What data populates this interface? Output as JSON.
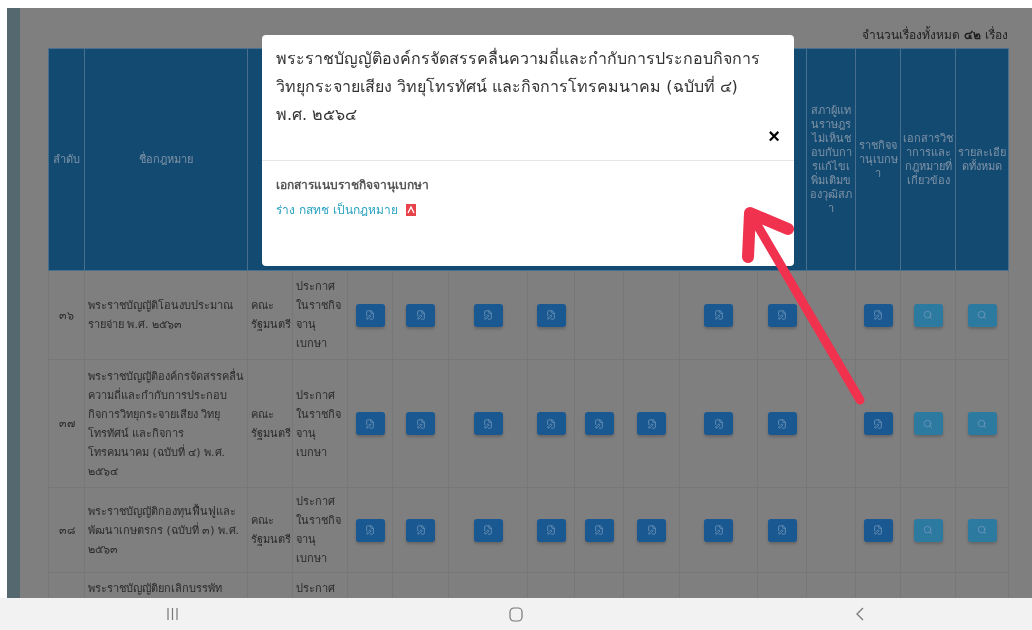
{
  "summary": "จำนวนเรื่องทั้งหมด **๔๒** เรื่อง",
  "table": {
    "columns": [
      {
        "label": "ลำดับ"
      },
      {
        "label": "ชื่อกฎหมาย"
      },
      {
        "label": "สภาผู้แทนราษฎรไม่เห็นชอบกับการแก้ไขเพิ่มเติมของวุฒิสภา"
      },
      {
        "label": "ราชกิจจานุเบกษา"
      },
      {
        "label": "เอกสารวิชาการและกฎหมายที่เกี่ยวข้อง"
      },
      {
        "label": "รายละเอียดทั้งหมด"
      }
    ],
    "rows": [
      {
        "number": "๓๖",
        "name": "พระราชบัญญัติโอนงบประมาณรายจ่าย พ.ศ. ๒๕๖๓",
        "proposer": "คณะรัฐมนตรี",
        "status": "ประกาศในราชกิจจานุเบกษา",
        "actions": [
          {
            "kind": "edit"
          },
          {
            "kind": "edit"
          },
          {
            "kind": "edit"
          },
          {
            "kind": "edit"
          },
          {
            "kind": "empty"
          },
          {
            "kind": "empty"
          },
          {
            "kind": "edit"
          },
          {
            "kind": "edit"
          },
          {
            "kind": "empty"
          },
          {
            "kind": "edit"
          },
          {
            "kind": "search"
          },
          {
            "kind": "search"
          }
        ]
      },
      {
        "number": "๓๗",
        "name": "พระราชบัญญัติองค์กรจัดสรรคลื่นความถี่และกำกับการประกอบกิจการวิทยุกระจายเสียง วิทยุโทรทัศน์ และกิจการโทรคมนาคม (ฉบับที่ ๔) พ.ศ. ๒๕๖๔",
        "proposer": "คณะรัฐมนตรี",
        "status": "ประกาศในราชกิจจานุเบกษา",
        "actions": [
          {
            "kind": "edit"
          },
          {
            "kind": "edit"
          },
          {
            "kind": "edit"
          },
          {
            "kind": "edit"
          },
          {
            "kind": "edit"
          },
          {
            "kind": "edit"
          },
          {
            "kind": "edit"
          },
          {
            "kind": "edit"
          },
          {
            "kind": "empty"
          },
          {
            "kind": "edit"
          },
          {
            "kind": "search"
          },
          {
            "kind": "search"
          }
        ]
      },
      {
        "number": "๓๘",
        "name": "พระราชบัญญัติกองทุนฟื้นฟูและพัฒนาเกษตรกร (ฉบับที่ ๓) พ.ศ. ๒๕๖๓",
        "proposer": "คณะรัฐมนตรี",
        "status": "ประกาศในราชกิจจานุเบกษา",
        "actions": [
          {
            "kind": "edit"
          },
          {
            "kind": "edit"
          },
          {
            "kind": "edit"
          },
          {
            "kind": "edit"
          },
          {
            "kind": "edit"
          },
          {
            "kind": "edit"
          },
          {
            "kind": "edit"
          },
          {
            "kind": "edit"
          },
          {
            "kind": "empty"
          },
          {
            "kind": "edit"
          },
          {
            "kind": "search"
          },
          {
            "kind": "search"
          }
        ]
      },
      {
        "name": "พระราชบัญญัติยกเลิกบรรพัท",
        "status": "ประกาศ",
        "actions": []
      }
    ]
  },
  "modal": {
    "title": "พระราชบัญญัติองค์กรจัดสรรคลื่นความถี่และกำกับการประกอบกิจการวิทยุกระจายเสียง วิทยุโทรทัศน์ และกิจการโทรคมนาคม (ฉบับที่ ๔) พ.ศ. ๒๕๖๔",
    "close": "×",
    "section": "เอกสารแนบราชกิจจานุเบกษา",
    "link": "ร่าง กสทช เป็นกฎหมาย"
  }
}
